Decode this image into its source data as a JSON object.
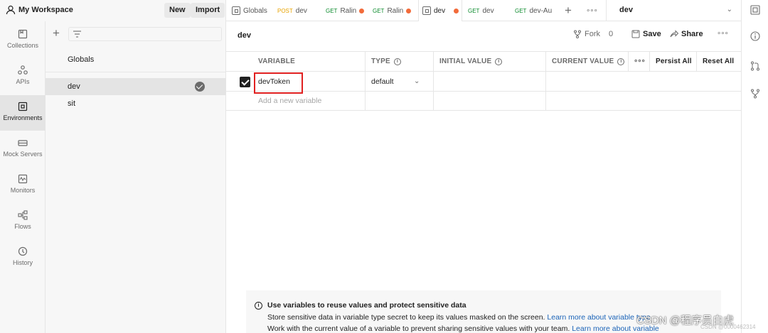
{
  "workspace": {
    "name": "My Workspace",
    "new_label": "New",
    "import_label": "Import"
  },
  "tabs": [
    {
      "method": "",
      "label": "Globals"
    },
    {
      "method": "POST",
      "label": "dev"
    },
    {
      "method": "GET",
      "label": "Ralin"
    },
    {
      "method": "GET",
      "label": "Ralin"
    },
    {
      "method": "",
      "label": "dev"
    },
    {
      "method": "GET",
      "label": "dev"
    },
    {
      "method": "GET",
      "label": "dev-Au"
    }
  ],
  "env_selector": {
    "value": "dev"
  },
  "sidebar": {
    "items": [
      {
        "label": "Collections"
      },
      {
        "label": "APIs"
      },
      {
        "label": "Environments"
      },
      {
        "label": "Mock Servers"
      },
      {
        "label": "Monitors"
      },
      {
        "label": "Flows"
      },
      {
        "label": "History"
      }
    ]
  },
  "env_list": {
    "globals": "Globals",
    "items": [
      {
        "label": "dev"
      },
      {
        "label": "sit"
      }
    ]
  },
  "main": {
    "title": "dev",
    "fork_label": "Fork",
    "fork_count": "0",
    "save_label": "Save",
    "share_label": "Share"
  },
  "table": {
    "headers": {
      "variable": "VARIABLE",
      "type": "TYPE",
      "initial": "INITIAL VALUE",
      "current": "CURRENT VALUE",
      "persist": "Persist All",
      "reset": "Reset All"
    },
    "rows": [
      {
        "variable": "devToken",
        "type": "default",
        "initial": "",
        "current": ""
      }
    ],
    "new_placeholder": "Add a new variable"
  },
  "banner": {
    "title": "Use variables to reuse values and protect sensitive data",
    "line1": "Store sensitive data in variable type secret to keep its values masked on the screen.",
    "line1_link": "Learn more about variable type",
    "line2": "Work with the current value of a variable to prevent sharing sensitive values with your team.",
    "line2_link": "Learn more about variable"
  },
  "watermark": {
    "main": "CSDN @程序员白虎",
    "sub": "CSDN @0000462314"
  }
}
